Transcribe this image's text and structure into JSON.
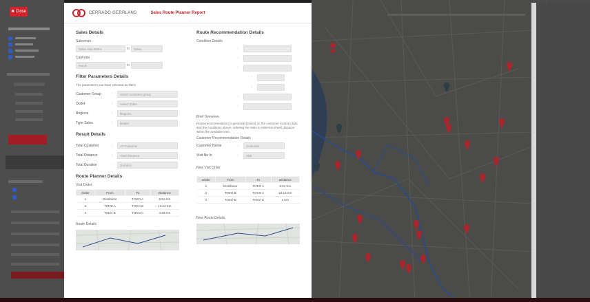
{
  "left_panel": {
    "close_label": "✖ Close"
  },
  "header": {
    "brand": "CERRADO GERRLANS",
    "title": "Sales Route Planner Report"
  },
  "sales_details": {
    "title": "Sales Details",
    "salesman_label": "Salesman",
    "salesman_value": "Sales Rep Name",
    "salesman_to": "to",
    "salesman_to_value": "Sales",
    "calendar_label": "Calendar",
    "calendar_value": "Month",
    "calendar_to": "to",
    "calendar_to_value": ""
  },
  "filter": {
    "title": "Filter Parameters Details",
    "note": "The parameters you have selected as filters",
    "rows": [
      {
        "label": "Customer Group",
        "value": "Select customer group"
      },
      {
        "label": "Outlet",
        "value": "Select outlet"
      },
      {
        "label": "Regions",
        "value": "Regions"
      },
      {
        "label": "Type Sales",
        "value": "Dealer"
      }
    ]
  },
  "result": {
    "title": "Result Details",
    "rows": [
      {
        "label": "Total Customer",
        "value": "10 Customer"
      },
      {
        "label": "Total Distance",
        "value": "Total Distance"
      },
      {
        "label": "Total Duration",
        "value": "Duration"
      }
    ]
  },
  "route_planner": {
    "title": "Route Planner Details",
    "visit_order_label": "Visit Order",
    "headers": [
      "Order",
      "From",
      "To",
      "Distance"
    ],
    "rows": [
      [
        "1",
        "Distributor",
        "TOKO A",
        "8.51 Km"
      ],
      [
        "2",
        "TOKO A",
        "TOKO B",
        "12.13 Km"
      ],
      [
        "3",
        "TOKO B",
        "TOKO C",
        "4.32 Km"
      ]
    ],
    "route_details_label": "Route Details"
  },
  "recommendation": {
    "title": "Route Recommendation Details",
    "subtitle": "Condition Details",
    "rows": [
      [
        "1",
        "Distributor",
        "TOKO A",
        "8.51 Km"
      ],
      [
        "2",
        "TOKO B",
        "TOKO A",
        "12.13 Km"
      ],
      [
        "3",
        "TOKO B",
        "TOKO C",
        "1 Km"
      ]
    ],
    "brief_label": "Brief Overview",
    "brief_text": "Route recommendation is generated based on the customer location data and the conditions above, ordering the visits to minimize travel distance within the available time.",
    "customer_rec_label": "Customer Recommendation Details",
    "customer_rows": [
      {
        "label": "Customer Name",
        "value": "Customer"
      },
      {
        "label": "Visit No In",
        "value": "Visit"
      }
    ],
    "new_visit_label": "New Visit Order",
    "headers": [
      "Order",
      "From",
      "To",
      "Distance"
    ],
    "new_route_label": "New Route Details"
  },
  "colors": {
    "accent": "#c6262e",
    "pin": "#c2262e",
    "route": "#274b8c"
  }
}
